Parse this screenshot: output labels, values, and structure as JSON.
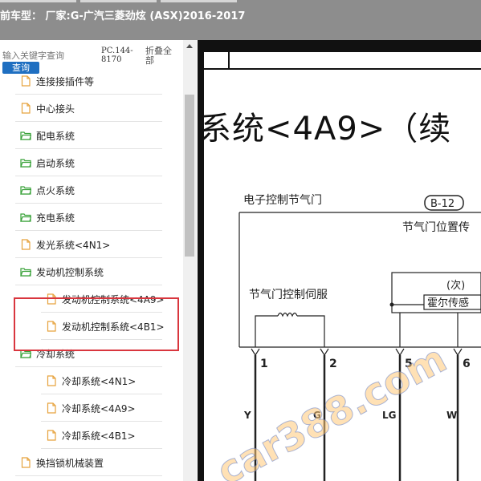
{
  "header": {
    "title": "前车型：  厂家:G-广汽三菱劲炫 (ASX)2016-2017"
  },
  "search": {
    "placeholder": "输入关键字查询",
    "button_label": "查询",
    "pc_code": "PC.144-8170",
    "collapse_all": "折叠全部"
  },
  "tree": {
    "items": [
      {
        "label": "连接接插件等",
        "icon": "file-icon",
        "indent": 1
      },
      {
        "label": "中心接头",
        "icon": "file-icon",
        "indent": 1
      },
      {
        "label": "配电系统",
        "icon": "folder-open-icon",
        "indent": 1
      },
      {
        "label": "启动系统",
        "icon": "folder-open-icon",
        "indent": 1
      },
      {
        "label": "点火系统",
        "icon": "folder-open-icon",
        "indent": 1
      },
      {
        "label": "充电系统",
        "icon": "folder-open-icon",
        "indent": 1
      },
      {
        "label": "发光系统<4N1>",
        "icon": "file-icon",
        "indent": 1
      },
      {
        "label": "发动机控制系统",
        "icon": "folder-open-icon",
        "indent": 1
      },
      {
        "label": "发动机控制系统<4A9>",
        "icon": "file-icon",
        "indent": 2
      },
      {
        "label": "发动机控制系统<4B1>",
        "icon": "file-icon",
        "indent": 2
      },
      {
        "label": "冷却系统",
        "icon": "folder-open-icon",
        "indent": 1
      },
      {
        "label": "冷却系统<4N1>",
        "icon": "file-icon",
        "indent": 2
      },
      {
        "label": "冷却系统<4A9>",
        "icon": "file-icon",
        "indent": 2
      },
      {
        "label": "冷却系统<4B1>",
        "icon": "file-icon",
        "indent": 2
      },
      {
        "label": "换挡锁机械装置",
        "icon": "file-icon",
        "indent": 1
      }
    ]
  },
  "document": {
    "title": "系统<4A9>（续",
    "label_ecu_throttle": "电子控制节气门",
    "connector": "B-12",
    "label_tps": "节气门位置传",
    "label_servo": "节气门控制伺服",
    "label_sub": "(次)",
    "label_hall": "霍尔传感",
    "pins": [
      "1",
      "2",
      "5",
      "6"
    ],
    "wires": [
      "Y",
      "G",
      "LG",
      "W"
    ],
    "watermark": "car388.com"
  },
  "colors": {
    "topbar": "#8d8d8d",
    "button": "#1f6fc1",
    "highlight": "#d9363e",
    "folder": "#3aa23a",
    "file": "#e6a23c"
  }
}
